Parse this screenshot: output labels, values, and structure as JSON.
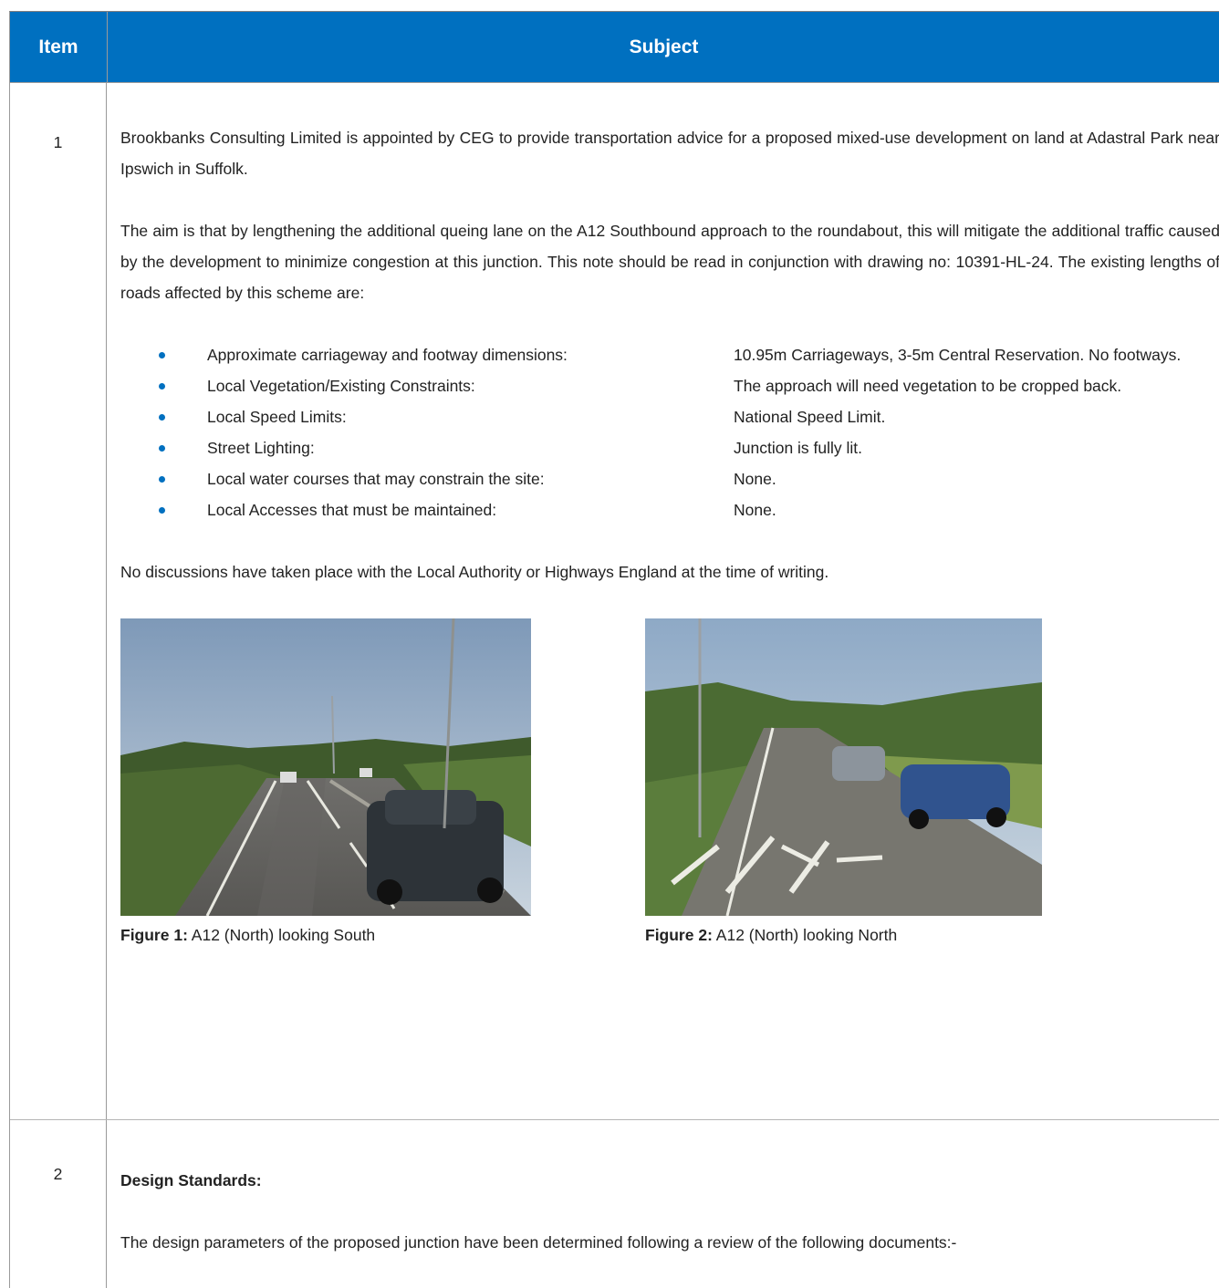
{
  "header": {
    "item_label": "Item",
    "subject_label": "Subject"
  },
  "rows": [
    {
      "item": "1",
      "paragraph1": "Brookbanks Consulting Limited is appointed by CEG to provide transportation advice for a proposed mixed-use development on land at Adastral Park near Ipswich in Suffolk.",
      "paragraph2": "The aim is that by lengthening the additional queing lane on the A12 Southbound approach to the roundabout, this will mitigate the additional traffic caused by the development to minimize congestion at this junction.  This note should be read in conjunction with drawing no: 10391-HL-24.  The existing lengths of roads affected by this scheme are:",
      "bullets": [
        {
          "label": "Approximate carriageway and footway dimensions:",
          "value": "10.95m Carriageways, 3-5m Central Reservation. No footways."
        },
        {
          "label": "Local Vegetation/Existing Constraints:",
          "value": "The approach will need vegetation to be cropped back."
        },
        {
          "label": "Local Speed Limits:",
          "value": "National Speed Limit."
        },
        {
          "label": "Street Lighting:",
          "value": "Junction is fully lit."
        },
        {
          "label": "Local water courses that may constrain the site:",
          "value": "None."
        },
        {
          "label": "Local Accesses that must be maintained:",
          "value": "None."
        }
      ],
      "paragraph3": "No discussions have taken place with the Local Authority or Highways England at the time of writing.",
      "figures": [
        {
          "label": "Figure 1:",
          "caption": " A12 (North) looking South"
        },
        {
          "label": "Figure 2:",
          "caption": " A12 (North) looking North"
        }
      ]
    },
    {
      "item": "2",
      "heading": "Design Standards:",
      "paragraph1": "The design parameters of the proposed junction have been determined following a review of the following documents:-"
    }
  ]
}
